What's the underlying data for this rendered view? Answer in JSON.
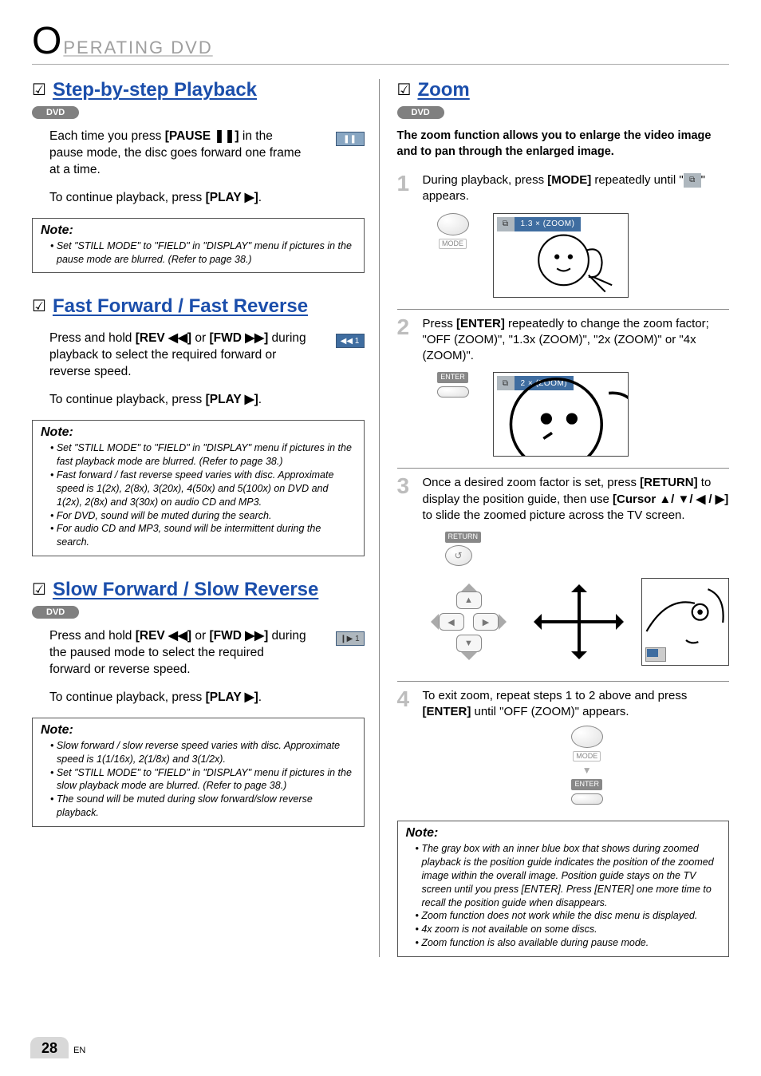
{
  "header": {
    "bigLetter": "O",
    "rest": "PERATING  DVD"
  },
  "left": {
    "step": {
      "title": "Step-by-step Playback",
      "chip": "DVD",
      "p1_a": "Each time you press ",
      "p1_b": "[PAUSE ❚❚]",
      "p1_c": " in the pause mode, the disc goes forward one frame at a time.",
      "osd_pause": "❚❚",
      "p2_a": "To continue playback, press ",
      "p2_b": "[PLAY ▶]",
      "p2_c": ".",
      "note_title": "Note:",
      "note_items": [
        "• Set \"STILL MODE\" to \"FIELD\" in \"DISPLAY\" menu if pictures in the pause mode are blurred. (Refer to page 38.)"
      ]
    },
    "ff": {
      "title": "Fast Forward / Fast Reverse",
      "p1_a": "Press and hold ",
      "p1_b": "[REV ◀◀]",
      "p1_c": " or ",
      "p1_d": "[FWD ▶▶]",
      "p1_e": " during playback to select the required forward or reverse speed.",
      "osd_rew": "◀◀ 1",
      "p2_a": "To continue playback, press ",
      "p2_b": "[PLAY ▶]",
      "p2_c": ".",
      "note_title": "Note:",
      "note_items": [
        "• Set \"STILL MODE\" to \"FIELD\" in \"DISPLAY\" menu if pictures in the fast playback mode are blurred. (Refer to page 38.)",
        "• Fast forward / fast reverse speed varies with disc. Approximate speed is 1(2x), 2(8x), 3(20x), 4(50x) and 5(100x) on DVD and 1(2x), 2(8x) and 3(30x) on audio CD and MP3.",
        "• For DVD, sound will be muted during the search.",
        "• For audio CD and MP3, sound will be intermittent during the search."
      ]
    },
    "slow": {
      "title": "Slow Forward / Slow Reverse",
      "chip": "DVD",
      "p1_a": "Press and hold ",
      "p1_b": "[REV ◀◀]",
      "p1_c": " or ",
      "p1_d": "[FWD ▶▶]",
      "p1_e": " during the paused mode to select the required forward or reverse speed.",
      "osd_slow": "❙▶ 1",
      "p2_a": "To continue playback, press ",
      "p2_b": "[PLAY ▶]",
      "p2_c": ".",
      "note_title": "Note:",
      "note_items": [
        "• Slow forward / slow reverse speed varies with disc. Approximate speed is 1(1/16x), 2(1/8x) and 3(1/2x).",
        "• Set \"STILL MODE\"  to \"FIELD\" in \"DISPLAY\" menu if pictures in the slow playback mode are blurred. (Refer to page 38.)",
        "• The sound will be muted during slow forward/slow reverse playback."
      ]
    }
  },
  "right": {
    "zoom": {
      "title": "Zoom",
      "chip": "DVD",
      "intro": "The zoom function allows you to enlarge the video image and to pan through the enlarged image.",
      "step1_a": "During playback, press ",
      "step1_b": "[MODE]",
      "step1_c": " repeatedly until \"",
      "step1_d": "\" appears.",
      "label_mode": "MODE",
      "osd1": "1.3 ×  (ZOOM)",
      "step2_a": "Press ",
      "step2_b": "[ENTER]",
      "step2_c": " repeatedly to change the zoom factor; \"OFF (ZOOM)\", \"1.3x (ZOOM)\", \"2x (ZOOM)\" or \"4x (ZOOM)\".",
      "label_enter": "ENTER",
      "osd2": "2 × (ZOOM)",
      "step3_a": "Once a desired zoom factor is set, press ",
      "step3_b": "[RETURN]",
      "step3_c": " to display the position guide, then use ",
      "step3_d": "[Cursor ▲/ ▼/ ◀ / ▶]",
      "step3_e": " to slide the zoomed picture across the TV screen.",
      "label_return": "RETURN",
      "step4_a": "To exit zoom, repeat steps 1 to 2 above and press ",
      "step4_b": "[ENTER]",
      "step4_c": " until \"OFF (ZOOM)\" appears.",
      "note_title": "Note:",
      "note_items": [
        "• The gray box with an inner blue box that shows during zoomed playback is the position guide indicates the position of the zoomed image within the overall image. Position guide stays on the TV screen until you press [ENTER]. Press [ENTER] one more time to recall the position guide when disappears.",
        "• Zoom function does not work while the disc menu is displayed.",
        "• 4x zoom is not available on some discs.",
        "• Zoom function is also available during pause mode."
      ]
    }
  },
  "footer": {
    "page": "28",
    "lang": "EN"
  },
  "icons": {
    "osd_icon": "⧉"
  }
}
